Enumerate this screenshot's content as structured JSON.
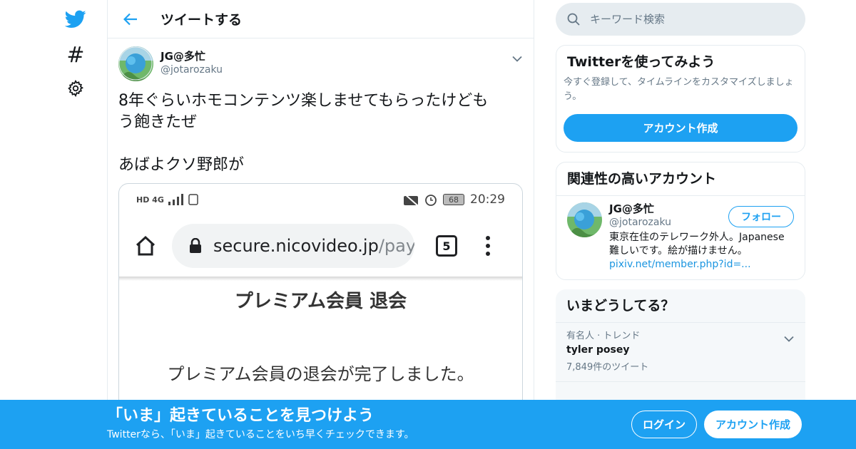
{
  "nav": {
    "icons": [
      "twitter-bird-icon",
      "hashtag-icon",
      "gear-icon"
    ],
    "hash_glyph": "#"
  },
  "main": {
    "title": "ツイートする",
    "tweet": {
      "author_name": "JG@多忙",
      "author_handle": "@jotarozaku",
      "text": "8年ぐらいホモコンテンツ楽しませてもらったけども\nう飽きたぜ\n\nあばよクソ野郎が",
      "media": {
        "status_left": "HD 4G",
        "battery": "68",
        "time": "20:29",
        "url_main": "secure.nicovideo.jp",
        "url_rest": "/pay",
        "tab_count": "5",
        "page_title": "プレミアム会員 退会",
        "page_message": "プレミアム会員の退会が完了しました。"
      }
    }
  },
  "right": {
    "search": {
      "placeholder": "キーワード検索"
    },
    "signup_card": {
      "title": "Twitterを使ってみよう",
      "subtitle": "今すぐ登録して、タイムラインをカスタマイズしましょう。",
      "button": "アカウント作成"
    },
    "related_card": {
      "title": "関連性の高いアカウント",
      "user": {
        "name": "JG@多忙",
        "handle": "@jotarozaku",
        "bio": "東京在住のテレワーク外人。Japanese 難しいです。絵が描けません。",
        "link": "pixiv.net/member.php?id=...",
        "follow": "フォロー"
      }
    },
    "trends_card": {
      "title": "いまどうしてる？",
      "items": [
        {
          "meta": "有名人 · トレンド",
          "name": "tyler posey",
          "count": "7,849件のツイート"
        }
      ]
    }
  },
  "banner": {
    "title": "「いま」起きていることを見つけよう",
    "subtitle": "Twitterなら、「いま」起きていることをいち早くチェックできます。",
    "login": "ログイン",
    "signup": "アカウント作成"
  },
  "colors": {
    "accent": "#1da1f2",
    "border": "#e6ecf0",
    "secondary_text": "#657786"
  }
}
